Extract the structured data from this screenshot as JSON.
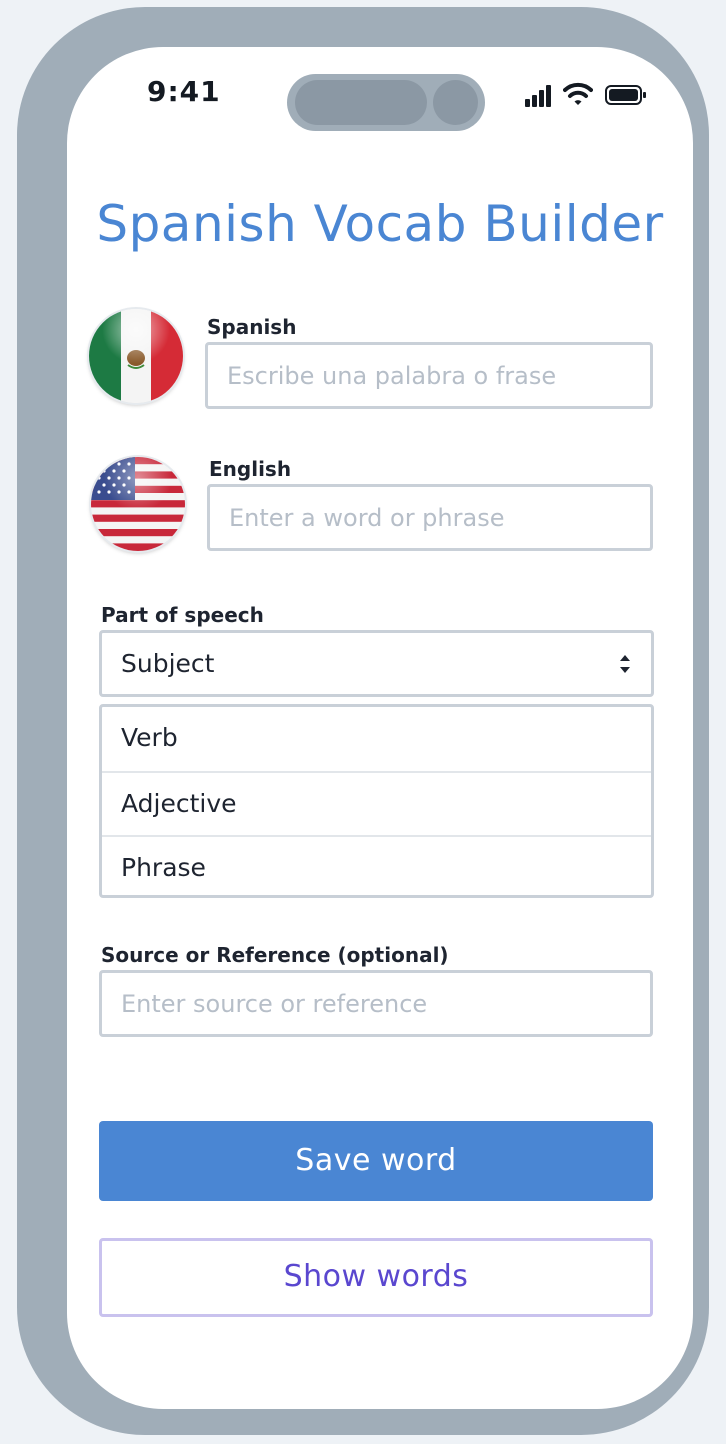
{
  "status_bar": {
    "time": "9:41"
  },
  "app": {
    "title": "Spanish Vocab Builder"
  },
  "spanish": {
    "label": "Spanish",
    "placeholder": "Escribe una palabra o frase",
    "value": "",
    "flag_icon": "mexico-flag-icon"
  },
  "english": {
    "label": "English",
    "placeholder": "Enter a word or phrase",
    "value": "",
    "flag_icon": "usa-flag-icon"
  },
  "part_of_speech": {
    "label": "Part of speech",
    "selected": "Subject",
    "options": [
      "Verb",
      "Adjective",
      "Phrase"
    ]
  },
  "source": {
    "label": "Source or Reference (optional)",
    "placeholder": "Enter source or reference",
    "value": ""
  },
  "actions": {
    "save_label": "Save word",
    "show_label": "Show words"
  },
  "colors": {
    "accent": "#4a86d3",
    "secondary_text": "#5a47cf",
    "frame": "#a0adb8"
  }
}
